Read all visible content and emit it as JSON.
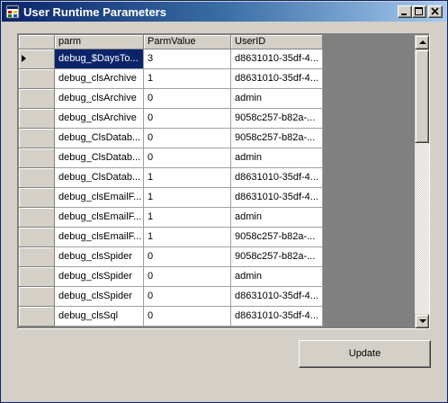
{
  "window": {
    "title": "User Runtime Parameters"
  },
  "grid": {
    "columns": [
      "parm",
      "ParmValue",
      "UserID"
    ],
    "rows": [
      [
        "debug_$DaysTo...",
        "3",
        "d8631010-35df-4..."
      ],
      [
        "debug_clsArchive",
        "1",
        "d8631010-35df-4..."
      ],
      [
        "debug_clsArchive",
        "0",
        "admin"
      ],
      [
        "debug_clsArchive",
        "0",
        "9058c257-b82a-..."
      ],
      [
        "debug_ClsDatab...",
        "0",
        "9058c257-b82a-..."
      ],
      [
        "debug_ClsDatab...",
        "0",
        "admin"
      ],
      [
        "debug_ClsDatab...",
        "1",
        "d8631010-35df-4..."
      ],
      [
        "debug_clsEmailF...",
        "1",
        "d8631010-35df-4..."
      ],
      [
        "debug_clsEmailF...",
        "1",
        "admin"
      ],
      [
        "debug_clsEmailF...",
        "1",
        "9058c257-b82a-..."
      ],
      [
        "debug_clsSpider",
        "0",
        "9058c257-b82a-..."
      ],
      [
        "debug_clsSpider",
        "0",
        "admin"
      ],
      [
        "debug_clsSpider",
        "0",
        "d8631010-35df-4..."
      ],
      [
        "debug_clsSql",
        "0",
        "d8631010-35df-4..."
      ]
    ]
  },
  "buttons": {
    "update": "Update"
  },
  "icons": {
    "app": "app-window-icon",
    "minimize": "minimize-icon",
    "maximize": "maximize-icon",
    "close": "close-icon",
    "current_row": "row-pointer-icon"
  }
}
